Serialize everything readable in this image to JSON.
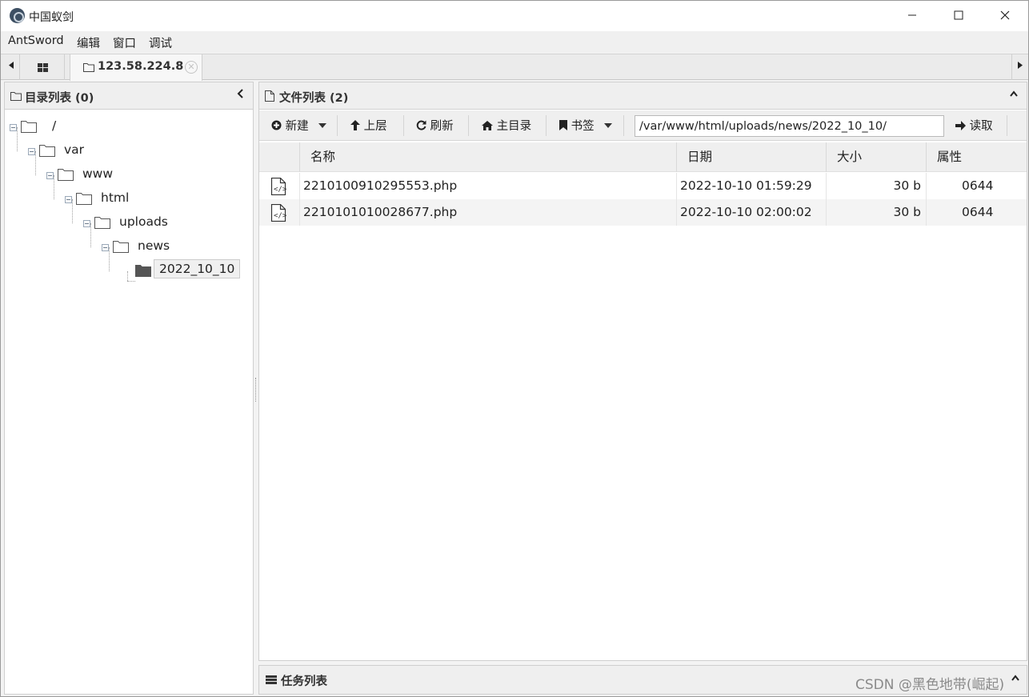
{
  "window": {
    "title": "中国蚁剑",
    "min_symbol": "—",
    "max_symbol": "☐",
    "close_symbol": "✕"
  },
  "menu": [
    "AntSword",
    "编辑",
    "窗口",
    "调试"
  ],
  "tabs": {
    "active_label": "123.58.224.8",
    "close_symbol": "✕",
    "left_arrow": "◀",
    "right_arrow": "▶"
  },
  "directory_panel": {
    "title": "目录列表 (0)",
    "collapse_symbol": "‹",
    "tree": [
      {
        "label": "/",
        "depth": 0
      },
      {
        "label": "var",
        "depth": 1
      },
      {
        "label": "www",
        "depth": 2
      },
      {
        "label": "html",
        "depth": 3
      },
      {
        "label": "uploads",
        "depth": 4
      },
      {
        "label": "news",
        "depth": 5
      },
      {
        "label": "2022_10_10",
        "depth": 6,
        "selected": true
      }
    ]
  },
  "file_panel": {
    "title": "文件列表 (2)",
    "collapse_symbol": "⌃",
    "toolbar": {
      "new_label": "新建",
      "up_label": "上层",
      "refresh_label": "刷新",
      "home_label": "主目录",
      "bookmark_label": "书签",
      "path_value": "/var/www/html/uploads/news/2022_10_10/",
      "read_label": "读取"
    },
    "columns": [
      "名称",
      "日期",
      "大小",
      "属性"
    ],
    "rows": [
      {
        "name": "2210100910295553.php",
        "date": "2022-10-10 01:59:29",
        "size": "30 b",
        "perm": "0644"
      },
      {
        "name": "2210101010028677.php",
        "date": "2022-10-10 02:00:02",
        "size": "30 b",
        "perm": "0644"
      }
    ]
  },
  "task_panel": {
    "title": "任务列表"
  },
  "watermark": "CSDN @黑色地带(崛起)",
  "colors": {
    "panel_header_bg": "#efefef",
    "selected_bg": "#f0f0f0",
    "alt_row_bg": "#f4f4f4"
  }
}
